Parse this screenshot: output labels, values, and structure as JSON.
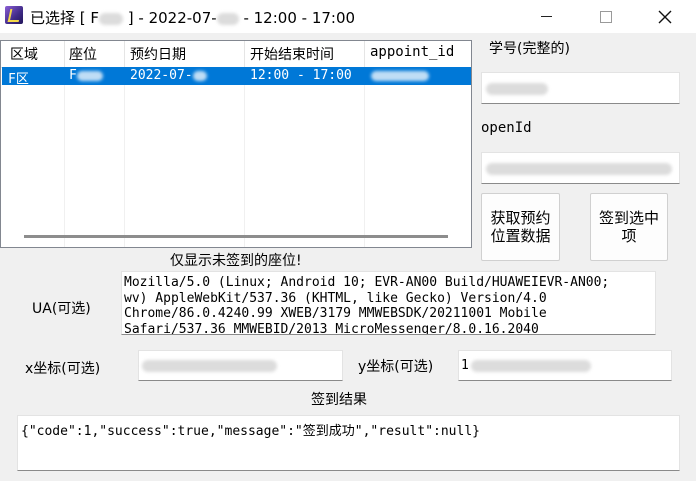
{
  "window": {
    "title_prefix": "已选择 [ F",
    "title_mid": " ] - 2022-07-",
    "title_suffix": " - 12:00 - 17:00"
  },
  "table": {
    "columns": [
      "区域",
      "座位",
      "预约日期",
      "开始结束时间",
      "appoint_id"
    ],
    "selected_row": {
      "area": "F区",
      "seat": "F",
      "date": "2022-07-",
      "time": "12:00 - 17:00",
      "appoint_id": ""
    }
  },
  "labels": {
    "student_id": "学号(完整的)",
    "open_id": "openId",
    "note": "仅显示未签到的座位!",
    "ua": "UA(可选)",
    "x_coord": "x坐标(可选)",
    "y_coord": "y坐标(可选)",
    "result_heading": "签到结果"
  },
  "buttons": {
    "fetch_line1": "获取预约",
    "fetch_line2": "位置数据",
    "signin_line1": "签到选中",
    "signin_line2": "项"
  },
  "fields": {
    "ua_value": "Mozilla/5.0 (Linux; Android 10; EVR-AN00 Build/HUAWEIEVR-AN00;\nwv) AppleWebKit/537.36 (KHTML, like Gecko) Version/4.0\nChrome/86.0.4240.99 XWEB/3179 MMWEBSDK/20211001 Mobile\nSafari/537.36 MMWEBID/2013 MicroMessenger/8.0.16.2040",
    "y_value": "1",
    "result_value": "{\"code\":1,\"success\":true,\"message\":\"签到成功\",\"result\":null}"
  },
  "icons": {
    "app": "app-icon",
    "minimize": "minimize-icon",
    "maximize": "maximize-icon",
    "close": "close-icon"
  }
}
